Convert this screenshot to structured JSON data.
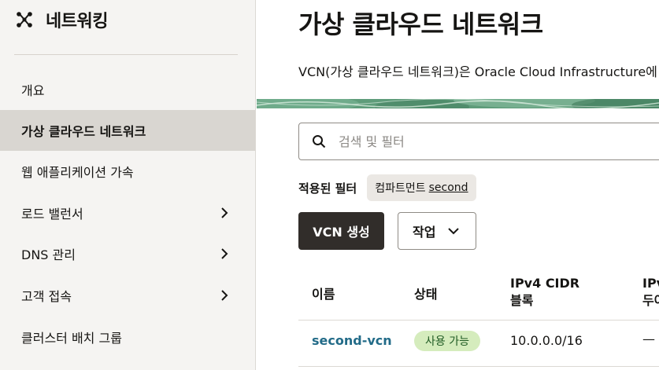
{
  "sidebar": {
    "title": "네트워킹",
    "items": [
      {
        "label": "개요",
        "active": false,
        "has_submenu": false
      },
      {
        "label": "가상 클라우드 네트워크",
        "active": true,
        "has_submenu": false
      },
      {
        "label": "웹 애플리케이션 가속",
        "active": false,
        "has_submenu": false
      },
      {
        "label": "로드 밸런서",
        "active": false,
        "has_submenu": true
      },
      {
        "label": "DNS 관리",
        "active": false,
        "has_submenu": true
      },
      {
        "label": "고객 접속",
        "active": false,
        "has_submenu": true
      },
      {
        "label": "클러스터 배치 그룹",
        "active": false,
        "has_submenu": false
      }
    ]
  },
  "main": {
    "title": "가상 클라우드 네트워크",
    "description": "VCN(가상 클라우드 네트워크)은 Oracle Cloud Infrastructure에",
    "search": {
      "placeholder": "검색 및 필터",
      "value": ""
    },
    "filters": {
      "label": "적용된 필터",
      "chips": [
        {
          "name": "컴파트먼트",
          "value": "second"
        }
      ]
    },
    "actions": {
      "create_label": "VCN 생성",
      "actions_label": "작업"
    },
    "table": {
      "columns": [
        "이름",
        "상태",
        "IPv4 CIDR 블록",
        "IPv"
      ],
      "column_lines": [
        [
          "이름"
        ],
        [
          "상태"
        ],
        [
          "IPv4 CIDR",
          "블록"
        ],
        [
          "IPv",
          "두어"
        ]
      ],
      "rows": [
        {
          "name": "second-vcn",
          "status": "사용 가능",
          "ipv4_cidr": "10.0.0.0/16",
          "ipv6": "—"
        }
      ]
    }
  },
  "colors": {
    "sidebar_bg": "#f5f4f2",
    "active_item_bg": "#d9d6d1",
    "primary_button": "#312d2a",
    "link": "#226b88",
    "status_available_bg": "#d5ecbd",
    "banner_green": "#5e9c7a"
  },
  "icons": {
    "sidebar_header": "network-icon",
    "search": "search-icon",
    "submenu": "chevron-right-icon",
    "dropdown": "chevron-down-icon"
  }
}
